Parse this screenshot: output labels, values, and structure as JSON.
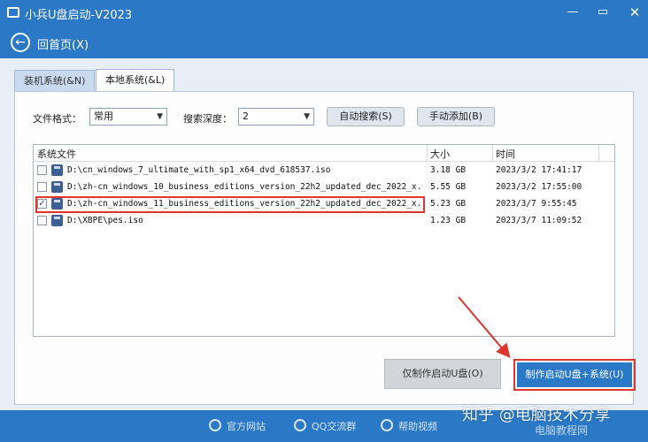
{
  "title": "小兵U盘启动-V2023",
  "window_controls": [
    "—",
    "▭",
    "✕"
  ],
  "nav": {
    "back_label": "回首页(X)"
  },
  "tabs": [
    {
      "label": "装机系统(&N)",
      "active": false
    },
    {
      "label": "本地系统(&L)",
      "active": true
    }
  ],
  "filters": {
    "format_label": "文件格式：",
    "format_value": "常用",
    "depth_label": "搜索深度：",
    "depth_value": "2",
    "auto_search_label": "自动搜索(S)",
    "manual_add_label": "手动添加(B)"
  },
  "table": {
    "headers": [
      "系统文件",
      "大小",
      "时间"
    ],
    "rows": [
      {
        "name": "D:\\cn_windows_7_ultimate_with_sp1_x64_dvd_618537.iso",
        "size": "3.18 GB",
        "time": "2023/3/2  17:41:17",
        "checked": false
      },
      {
        "name": "D:\\zh-cn_windows_10_business_editions_version_22h2_updated_dec_2022_x...",
        "size": "5.55 GB",
        "time": "2023/3/2  17:55:00",
        "checked": false
      },
      {
        "name": "D:\\zh-cn_windows_11_business_editions_version_22h2_updated_dec_2022_x...",
        "size": "5.23 GB",
        "time": "2023/3/7  9:55:45",
        "checked": true
      },
      {
        "name": "D:\\XBPE\\pes.iso",
        "size": "1.23 GB",
        "time": "2023/3/7  11:09:52",
        "checked": false
      }
    ]
  },
  "actions": {
    "make_boot_only": "仅制作启动U盘(O)",
    "make_boot_and_system": "制作启动U盘+系统(U)"
  },
  "footer": {
    "links": [
      "官方网站",
      "QQ交流群",
      "帮助视频"
    ]
  },
  "watermark": {
    "main": "知乎 @电脑技术分享",
    "sub": "电脑教程网"
  },
  "colors": {
    "brand_blue": "#2a78c6",
    "highlight_red": "#e0342f"
  }
}
